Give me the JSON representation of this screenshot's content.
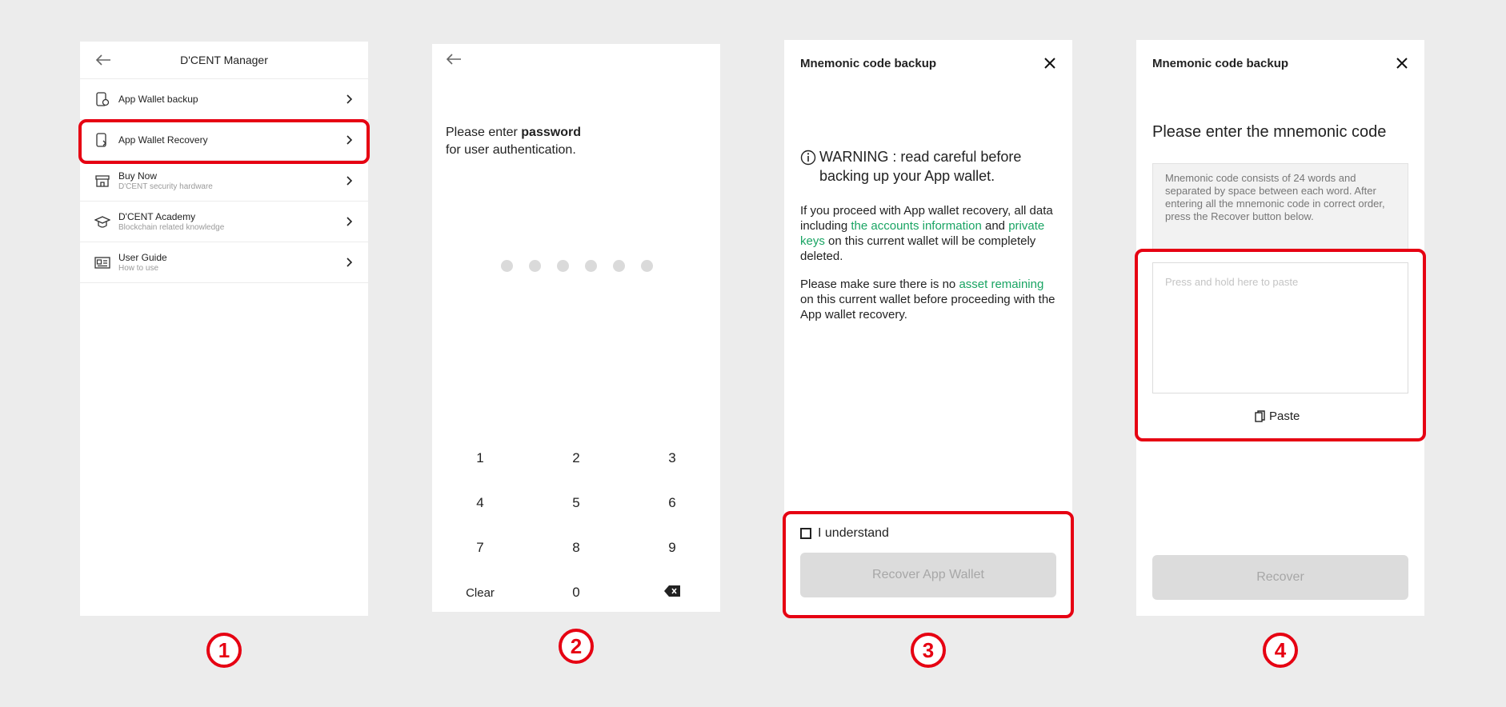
{
  "screen1": {
    "title": "D'CENT Manager",
    "items": [
      {
        "label": "App Wallet backup",
        "sub": ""
      },
      {
        "label": "App Wallet Recovery",
        "sub": ""
      },
      {
        "label": "Buy Now",
        "sub": "D'CENT security hardware"
      },
      {
        "label": "D'CENT Academy",
        "sub": "Blockchain related knowledge"
      },
      {
        "label": "User Guide",
        "sub": "How to use"
      }
    ],
    "step": "1"
  },
  "screen2": {
    "prompt_pre": "Please enter ",
    "prompt_bold": "password",
    "prompt_line2": "for user authentication.",
    "keys": [
      "1",
      "2",
      "3",
      "4",
      "5",
      "6",
      "7",
      "8",
      "9",
      "Clear",
      "0"
    ],
    "step": "2"
  },
  "screen3": {
    "title": "Mnemonic code backup",
    "warning": "WARNING : read careful before backing up your App wallet.",
    "p1_a": "If you proceed with App wallet recovery, all data including ",
    "p1_g1": "the accounts information",
    "p1_b": " and ",
    "p1_g2": "private keys",
    "p1_c": " on this current wallet will be completely deleted.",
    "p2_a": "Please make sure there is no ",
    "p2_g": "asset remaining",
    "p2_b": " on this current wallet before proceeding with the App wallet recovery.",
    "checkbox_label": "I understand",
    "button": "Recover App Wallet",
    "step": "3"
  },
  "screen4": {
    "title": "Mnemonic code backup",
    "heading": "Please enter the mnemonic code",
    "info": "Mnemonic code consists of 24 words and separated by space between each word. After entering all the mnemonic code in correct order, press the Recover button below.",
    "placeholder": "Press and hold here to paste",
    "paste": "Paste",
    "button": "Recover",
    "step": "4"
  },
  "colors": {
    "highlight": "#e60012",
    "green": "#19a463",
    "background": "#ececec"
  }
}
